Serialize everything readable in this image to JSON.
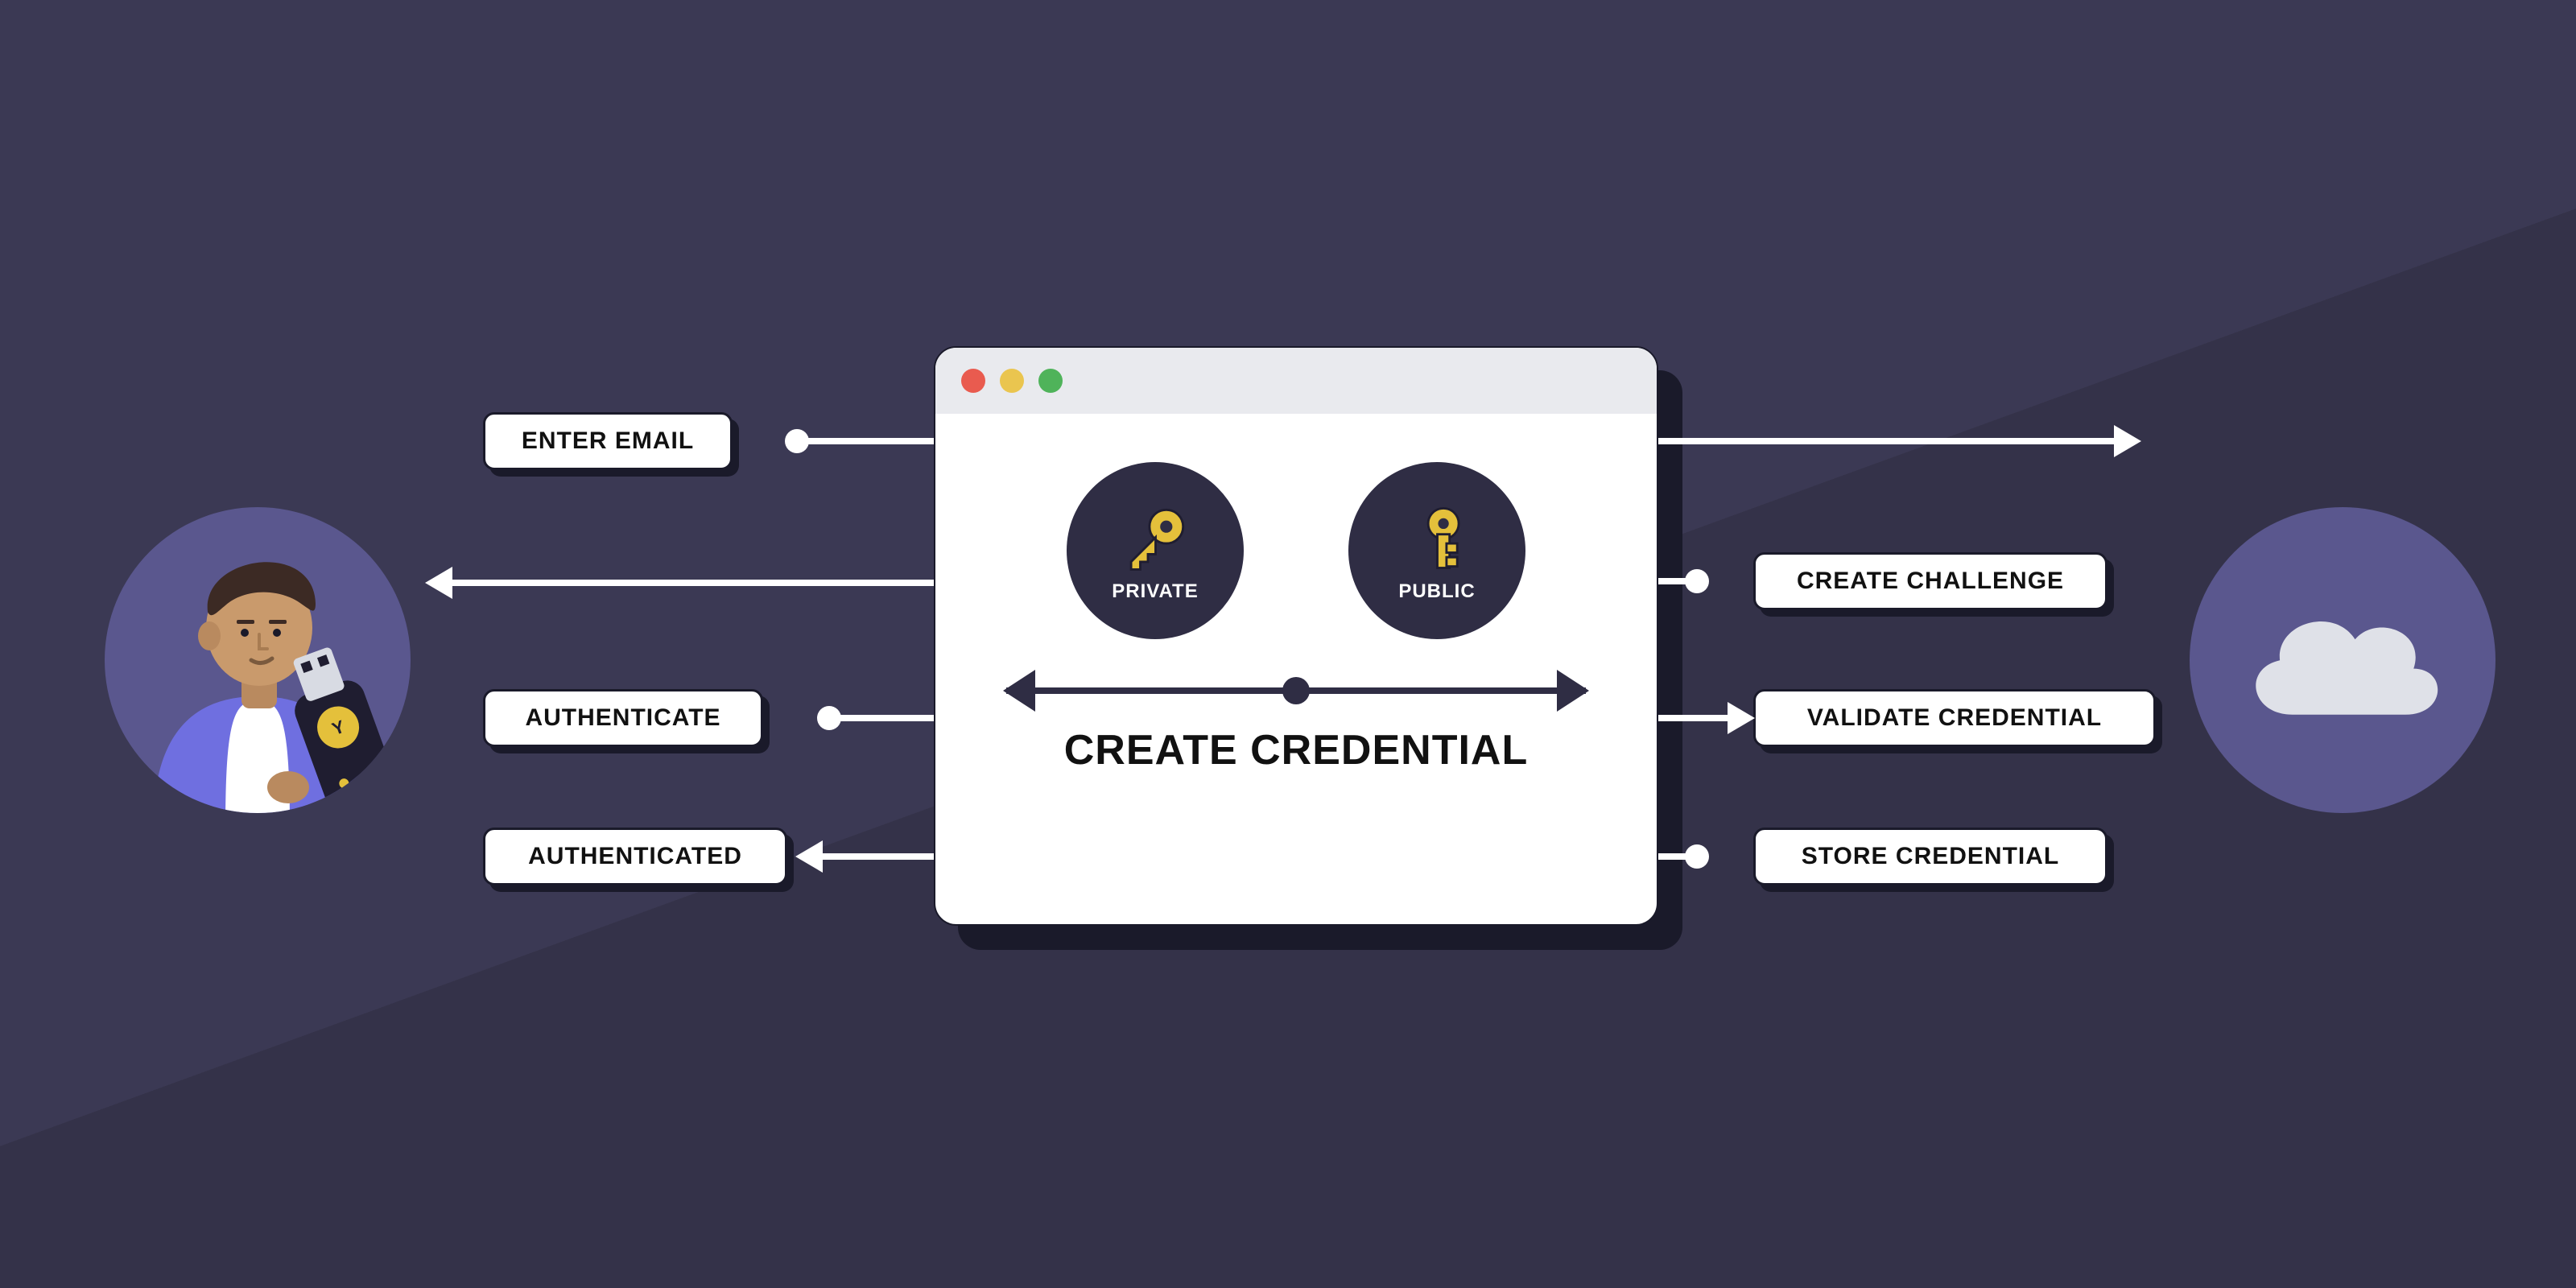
{
  "left_actor": "user-with-security-key",
  "right_actor": "cloud-server",
  "browser": {
    "keys": {
      "private": "PRIVATE",
      "public": "PUBLIC"
    },
    "credential_label": "CREATE CREDENTIAL"
  },
  "left_steps": {
    "enter_email": "ENTER EMAIL",
    "authenticate": "AUTHENTICATE",
    "authenticated": "AUTHENTICATED"
  },
  "right_steps": {
    "create_challenge": "CREATE CHALLENGE",
    "validate_credential": "VALIDATE CREDENTIAL",
    "store_credential": "STORE CREDENTIAL"
  }
}
